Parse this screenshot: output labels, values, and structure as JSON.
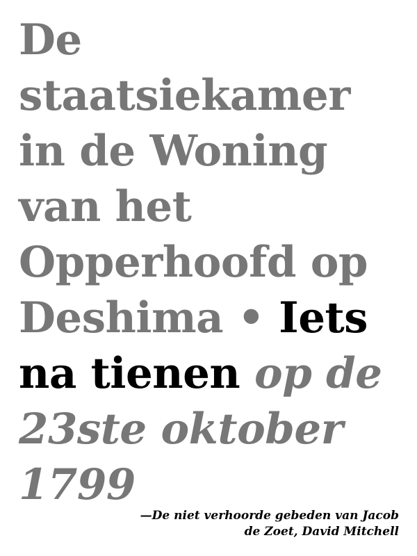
{
  "heading": {
    "location": "De staatsiekamer in de Woning van het Opperhoofd op Deshima",
    "separator": "•",
    "time": "Iets na tienen",
    "date": "op de 23ste oktober 1799"
  },
  "attribution": {
    "line1": "—De niet verhoorde gebeden van Jacob",
    "line2": "de Zoet, David Mitchell"
  }
}
